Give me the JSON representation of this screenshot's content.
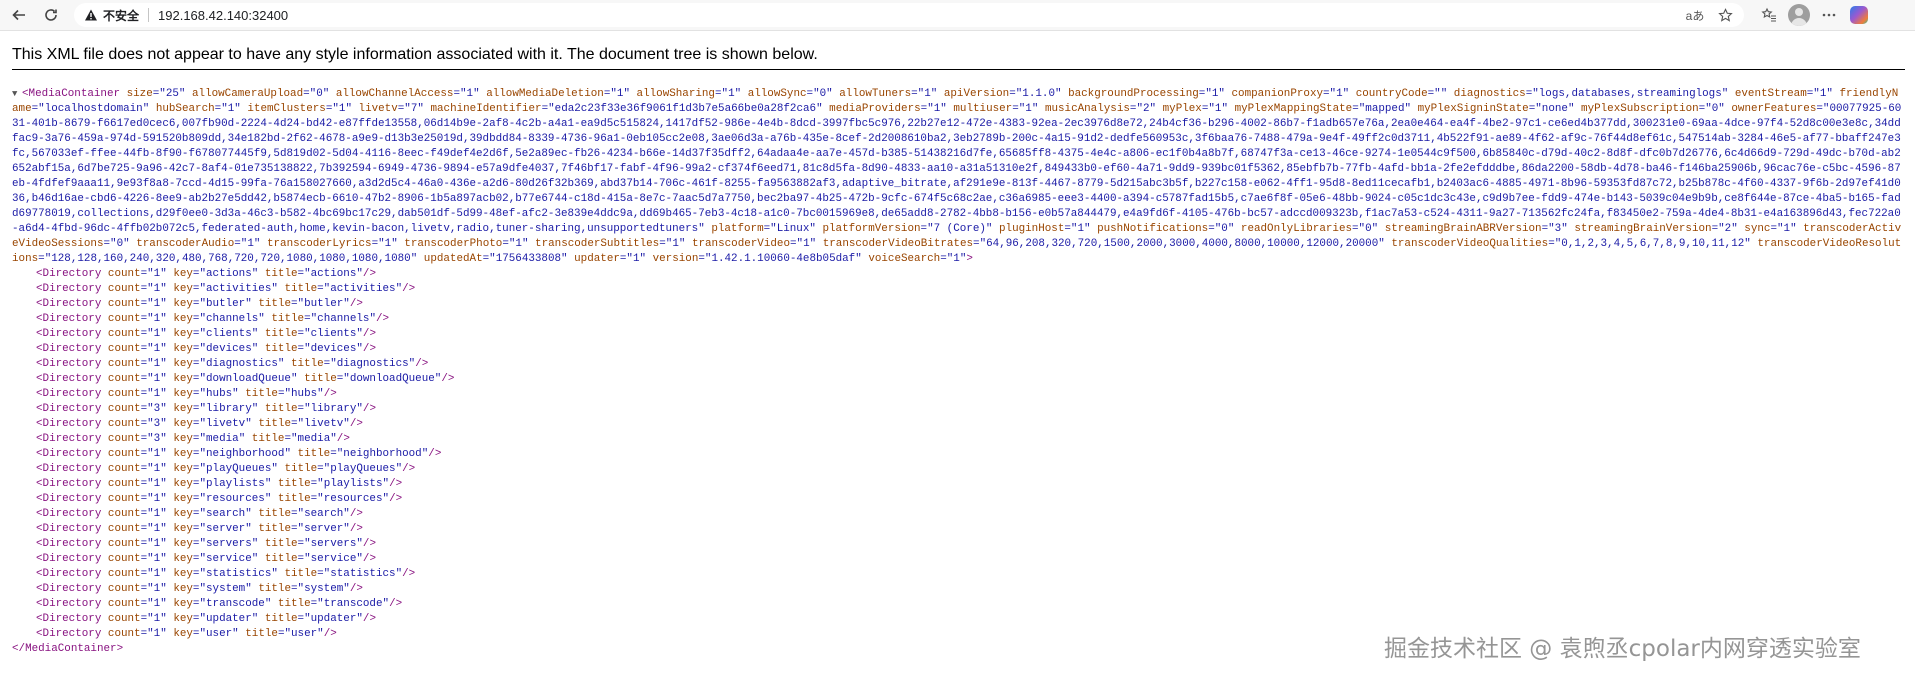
{
  "browser": {
    "insecure_label": "不安全",
    "url": "192.168.42.140:32400",
    "read_aloud_label": "aあ"
  },
  "info_message": "This XML file does not appear to have any style information associated with it. The document tree is shown below.",
  "root": {
    "tag_open": "<MediaContainer",
    "attrs": [
      {
        "n": "size",
        "v": "25"
      },
      {
        "n": "allowCameraUpload",
        "v": "0"
      },
      {
        "n": "allowChannelAccess",
        "v": "1"
      },
      {
        "n": "allowMediaDeletion",
        "v": "1"
      },
      {
        "n": "allowSharing",
        "v": "1"
      },
      {
        "n": "allowSync",
        "v": "0"
      },
      {
        "n": "allowTuners",
        "v": "1"
      },
      {
        "n": "apiVersion",
        "v": "1.1.0"
      },
      {
        "n": "backgroundProcessing",
        "v": "1"
      },
      {
        "n": "companionProxy",
        "v": "1"
      },
      {
        "n": "countryCode",
        "v": ""
      },
      {
        "n": "diagnostics",
        "v": "logs,databases,streaminglogs"
      },
      {
        "n": "eventStream",
        "v": "1"
      },
      {
        "n": "friendlyName",
        "v": "localhostdomain"
      },
      {
        "n": "hubSearch",
        "v": "1"
      },
      {
        "n": "itemClusters",
        "v": "1"
      },
      {
        "n": "livetv",
        "v": "7"
      },
      {
        "n": "machineIdentifier",
        "v": "eda2c23f33e36f9061f1d3b7e5a66be0a28f2ca6"
      },
      {
        "n": "mediaProviders",
        "v": "1"
      },
      {
        "n": "multiuser",
        "v": "1"
      },
      {
        "n": "musicAnalysis",
        "v": "2"
      },
      {
        "n": "myPlex",
        "v": "1"
      },
      {
        "n": "myPlexMappingState",
        "v": "mapped"
      },
      {
        "n": "myPlexSigninState",
        "v": "none"
      },
      {
        "n": "myPlexSubscription",
        "v": "0"
      },
      {
        "n": "ownerFeatures",
        "v": "00077925-6031-401b-8679-f6617ed0cec6,007fb90d-2224-4d24-bd42-e87ffde13558,06d14b9e-2af8-4c2b-a4a1-ea9d5c515824,1417df52-986e-4e4b-8dcd-3997fbc5c976,22b27e12-472e-4383-92ea-2ec3976d8e72,24b4cf36-b296-4002-86b7-f1adb657e76a,2ea0e464-ea4f-4be2-97c1-ce6ed4b377dd,300231e0-69aa-4dce-97f4-52d8c00e3e8c,34ddfac9-3a76-459a-974d-591520b809dd,34e182bd-2f62-4678-a9e9-d13b3e25019d,39dbdd84-8339-4736-96a1-0eb105cc2e08,3ae06d3a-a76b-435e-8cef-2d2008610ba2,3eb2789b-200c-4a15-91d2-dedfe560953c,3f6baa76-7488-479a-9e4f-49ff2c0d3711,4b522f91-ae89-4f62-af9c-76f44d8ef61c,547514ab-3284-46e5-af77-bbaff247e3fc,567033ef-ffee-44fb-8f90-f678077445f9,5d819d02-5d04-4116-8eec-f49def4e2d6f,5e2a89ec-fb26-4234-b66e-14d37f35dff2,64adaa4e-aa7e-457d-b385-51438216d7fe,65685ff8-4375-4e4c-a806-ec1f0b4a8b7f,68747f3a-ce13-46ce-9274-1e0544c9f500,6b85840c-d79d-40c2-8d8f-dfc0b7d26776,6c4d66d9-729d-49dc-b70d-ab2652abf15a,6d7be725-9a96-42c7-8af4-01e735138822,7b392594-6949-4736-9894-e57a9dfe4037,7f46bf17-fabf-4f96-99a2-cf374f6eed71,81c8d5fa-8d90-4833-aa10-a31a51310e2f,849433b0-ef60-4a71-9dd9-939bc01f5362,85ebfb7b-77fb-4afd-bb1a-2fe2efdddbe,86da2200-58db-4d78-ba46-f146ba25906b,96cac76e-c5bc-4596-87eb-4fdfef9aaa11,9e93f8a8-7ccd-4d15-99fa-76a158027660,a3d2d5c4-46a0-436e-a2d6-80d26f32b369,abd37b14-706c-461f-8255-fa9563882af3,adaptive_bitrate,af291e9e-813f-4467-8779-5d215abc3b5f,b227c158-e062-4ff1-95d8-8ed11cecafb1,b2403ac6-4885-4971-8b96-59353fd87c72,b25b878c-4f60-4337-9f6b-2d97ef41d036,b46d16ae-cbd6-4226-8ee9-ab2b27e5dd42,b5874ecb-6610-47b2-8906-1b5a897acb02,b77e6744-c18d-415a-8e7c-7aac5d7a7750,bec2ba97-4b25-472b-9cfc-674f5c68c2ae,c36a6985-eee3-4400-a394-c5787fad15b5,c7ae6f8f-05e6-48bb-9024-c05c1dc3c43e,c9d9b7ee-fdd9-474e-b143-5039c04e9b9b,ce8f644e-87ce-4ba5-b165-fadd69778019,collections,d29f0ee0-3d3a-46c3-b582-4bc69bc17c29,dab501df-5d99-48ef-afc2-3e839e4ddc9a,dd69b465-7eb3-4c18-a1c0-7bc0015969e8,de65add8-2782-4bb8-b156-e0b57a844479,e4a9fd6f-4105-476b-bc57-adccd009323b,f1ac7a53-c524-4311-9a27-713562fc24fa,f83450e2-759a-4de4-8b31-e4a163896d43,fec722a0-a6d4-4fbd-96dc-4ffb02b072c5,federated-auth,home,kevin-bacon,livetv,radio,tuner-sharing,unsupportedtuners"
      },
      {
        "n": "platform",
        "v": "Linux"
      },
      {
        "n": "platformVersion",
        "v": "7 (Core)"
      },
      {
        "n": "pluginHost",
        "v": "1"
      },
      {
        "n": "pushNotifications",
        "v": "0"
      },
      {
        "n": "readOnlyLibraries",
        "v": "0"
      },
      {
        "n": "streamingBrainABRVersion",
        "v": "3"
      },
      {
        "n": "streamingBrainVersion",
        "v": "2"
      },
      {
        "n": "sync",
        "v": "1"
      },
      {
        "n": "transcoderActiveVideoSessions",
        "v": "0"
      },
      {
        "n": "transcoderAudio",
        "v": "1"
      },
      {
        "n": "transcoderLyrics",
        "v": "1"
      },
      {
        "n": "transcoderPhoto",
        "v": "1"
      },
      {
        "n": "transcoderSubtitles",
        "v": "1"
      },
      {
        "n": "transcoderVideo",
        "v": "1"
      },
      {
        "n": "transcoderVideoBitrates",
        "v": "64,96,208,320,720,1500,2000,3000,4000,8000,10000,12000,20000"
      },
      {
        "n": "transcoderVideoQualities",
        "v": "0,1,2,3,4,5,6,7,8,9,10,11,12"
      },
      {
        "n": "transcoderVideoResolutions",
        "v": "128,128,160,240,320,480,768,720,720,1080,1080,1080,1080"
      },
      {
        "n": "updatedAt",
        "v": "1756433808"
      },
      {
        "n": "updater",
        "v": "1"
      },
      {
        "n": "version",
        "v": "1.42.1.10060-4e8b05daf"
      },
      {
        "n": "voiceSearch",
        "v": "1"
      }
    ],
    "close_tag": "</MediaContainer>"
  },
  "directories": [
    {
      "count": "1",
      "key": "actions",
      "title": "actions"
    },
    {
      "count": "1",
      "key": "activities",
      "title": "activities"
    },
    {
      "count": "1",
      "key": "butler",
      "title": "butler"
    },
    {
      "count": "1",
      "key": "channels",
      "title": "channels"
    },
    {
      "count": "1",
      "key": "clients",
      "title": "clients"
    },
    {
      "count": "1",
      "key": "devices",
      "title": "devices"
    },
    {
      "count": "1",
      "key": "diagnostics",
      "title": "diagnostics"
    },
    {
      "count": "1",
      "key": "downloadQueue",
      "title": "downloadQueue"
    },
    {
      "count": "1",
      "key": "hubs",
      "title": "hubs"
    },
    {
      "count": "3",
      "key": "library",
      "title": "library"
    },
    {
      "count": "3",
      "key": "livetv",
      "title": "livetv"
    },
    {
      "count": "3",
      "key": "media",
      "title": "media"
    },
    {
      "count": "1",
      "key": "neighborhood",
      "title": "neighborhood"
    },
    {
      "count": "1",
      "key": "playQueues",
      "title": "playQueues"
    },
    {
      "count": "1",
      "key": "playlists",
      "title": "playlists"
    },
    {
      "count": "1",
      "key": "resources",
      "title": "resources"
    },
    {
      "count": "1",
      "key": "search",
      "title": "search"
    },
    {
      "count": "1",
      "key": "server",
      "title": "server"
    },
    {
      "count": "1",
      "key": "servers",
      "title": "servers"
    },
    {
      "count": "1",
      "key": "service",
      "title": "service"
    },
    {
      "count": "1",
      "key": "statistics",
      "title": "statistics"
    },
    {
      "count": "1",
      "key": "system",
      "title": "system"
    },
    {
      "count": "1",
      "key": "transcode",
      "title": "transcode"
    },
    {
      "count": "1",
      "key": "updater",
      "title": "updater"
    },
    {
      "count": "1",
      "key": "user",
      "title": "user"
    }
  ],
  "watermark": "掘金技术社区 @ 袁煦丞cpolar内网穿透实验室"
}
